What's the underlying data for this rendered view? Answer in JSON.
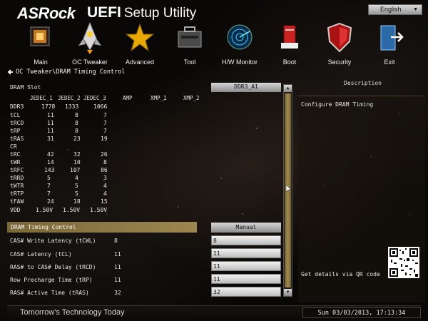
{
  "header": {
    "brand": "ASRock",
    "product": "UEFI",
    "subtitle": "Setup Utility",
    "language": "English"
  },
  "nav": [
    {
      "label": "Main",
      "icon": "main-icon"
    },
    {
      "label": "OC Tweaker",
      "icon": "rocket-icon"
    },
    {
      "label": "Advanced",
      "icon": "star-icon"
    },
    {
      "label": "Tool",
      "icon": "toolbox-icon"
    },
    {
      "label": "H/W Monitor",
      "icon": "radar-icon"
    },
    {
      "label": "Boot",
      "icon": "boot-icon"
    },
    {
      "label": "Security",
      "icon": "shield-icon"
    },
    {
      "label": "Exit",
      "icon": "exit-icon"
    }
  ],
  "breadcrumb": "OC Tweaker\\DRAM Timing Control",
  "dram_slot_label": "DRAM Slot",
  "slot_select": "DDR3_A1",
  "columns": [
    "JEDEC_1",
    "JEDEC_2",
    "JEDEC_3",
    "AMP",
    "XMP_1",
    "XMP_2"
  ],
  "spd": [
    {
      "name": "DDR3",
      "v": [
        "1778",
        "1333",
        "1066"
      ]
    },
    {
      "name": "tCL",
      "v": [
        "11",
        "8",
        "7"
      ]
    },
    {
      "name": "tRCD",
      "v": [
        "11",
        "8",
        "7"
      ]
    },
    {
      "name": "tRP",
      "v": [
        "11",
        "8",
        "7"
      ]
    },
    {
      "name": "tRAS",
      "v": [
        "31",
        "23",
        "19"
      ]
    },
    {
      "name": "CR",
      "v": [
        "",
        "",
        ""
      ]
    },
    {
      "name": "tRC",
      "v": [
        "42",
        "32",
        "26"
      ]
    },
    {
      "name": "tWR",
      "v": [
        "14",
        "10",
        "8"
      ]
    },
    {
      "name": "tRFC",
      "v": [
        "143",
        "107",
        "86"
      ]
    },
    {
      "name": "tRRD",
      "v": [
        "5",
        "4",
        "3"
      ]
    },
    {
      "name": "tWTR",
      "v": [
        "7",
        "5",
        "4"
      ]
    },
    {
      "name": "tRTP",
      "v": [
        "7",
        "5",
        "4"
      ]
    },
    {
      "name": "tFAW",
      "v": [
        "24",
        "18",
        "15"
      ]
    },
    {
      "name": "VDD",
      "v": [
        "1.50V",
        "1.50V",
        "1.50V"
      ]
    }
  ],
  "timing_control": {
    "label": "DRAM Timing Control",
    "mode": "Manual"
  },
  "settings": [
    {
      "label": "CAS# Write Latency (tCWL)",
      "value": "8",
      "input": "8"
    },
    {
      "label": "CAS# Latency (tCL)",
      "value": "11",
      "input": "11"
    },
    {
      "label": "RAS# to CAS# Delay (tRCD)",
      "value": "11",
      "input": "11"
    },
    {
      "label": "Row Precharge Time (tRP)",
      "value": "11",
      "input": "11"
    },
    {
      "label": "RAS# Active Time (tRAS)",
      "value": "32",
      "input": "32"
    }
  ],
  "description": {
    "title": "Description",
    "text": "Configure DRAM Timing",
    "qr_text": "Get details via QR code"
  },
  "footer": {
    "tagline": "Tomorrow's Technology Today",
    "datetime": "Sun 03/03/2013, 17:13:34"
  }
}
